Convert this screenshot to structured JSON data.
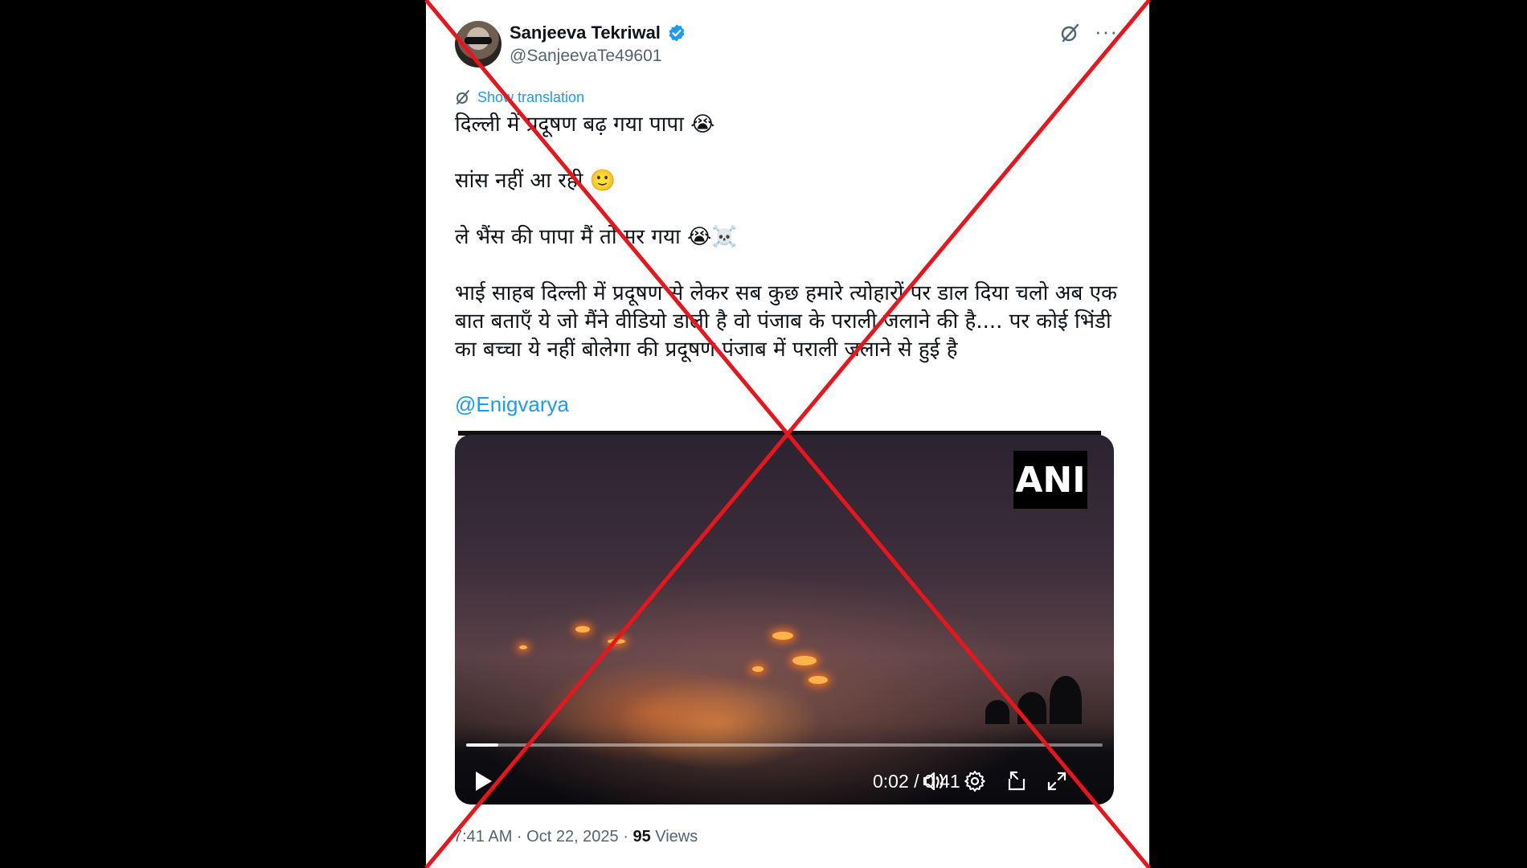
{
  "author": {
    "name": "Sanjeeva Tekriwal",
    "handle": "@SanjeevaTe49601"
  },
  "translate_label": "Show translation",
  "tweet_lines": [
    "दिल्ली में प्रदूषण बढ़ गया पापा 😭",
    "सांस नहीं आ रही 🙂",
    "ले भैंस की पापा मैं तो मर गया 😭☠️",
    "भाई साहब दिल्ली में प्रदूषण से लेकर सब कुछ हमारे त्योहारों पर डाल दिया चलो अब एक बात बताएँ ये जो मैंने वीडियो डाली है वो पंजाब के पराली जलाने की है.... पर कोई भिंडी का बच्चा ये नहीं बोलेगा की प्रदूषण पंजाब में पराली जलाने से हुई है"
  ],
  "mention": "@Enigvarya",
  "video": {
    "watermark": "ANI",
    "current_time": "0:02",
    "duration": "0:41",
    "time_display": "0:02 / 0:41",
    "progress_fraction": 0.05
  },
  "footer": {
    "time_date": "7:41 AM · Oct 22, 2025 · ",
    "views_count": "95",
    "views_label": " Views"
  },
  "colors": {
    "accent": "#1d9bf0",
    "cross": "#e8161c"
  }
}
